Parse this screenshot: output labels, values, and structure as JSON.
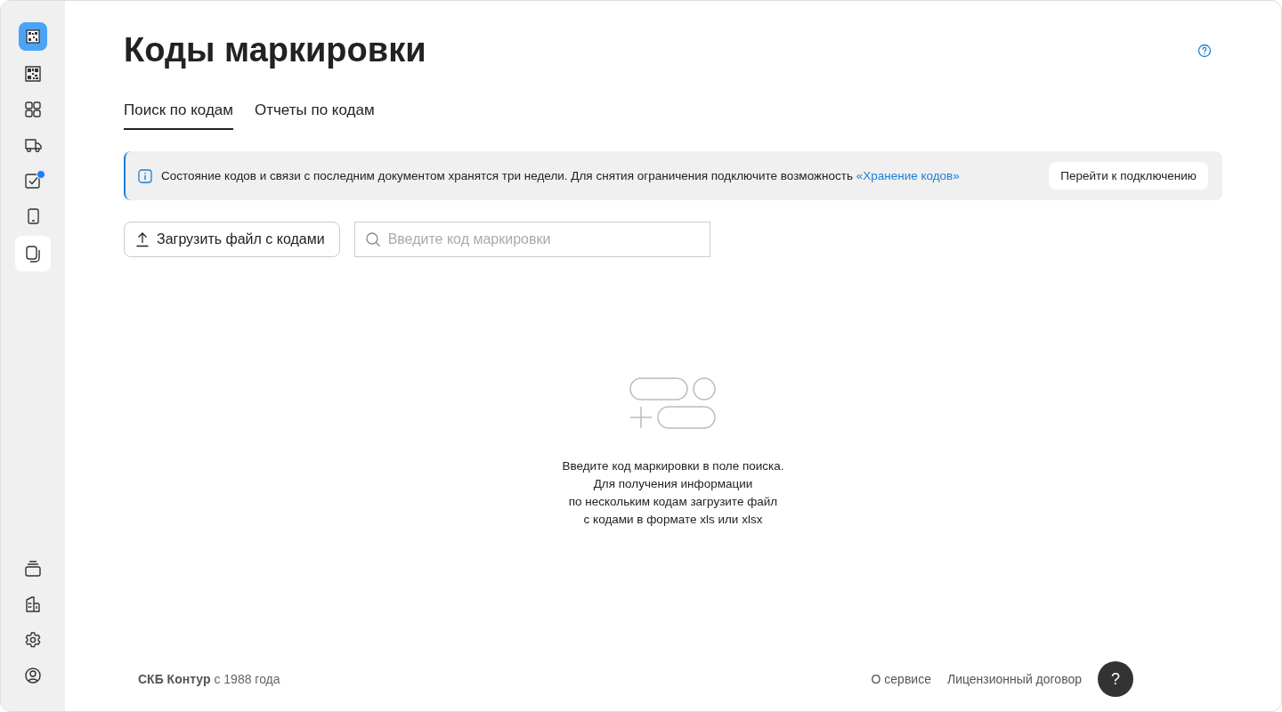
{
  "sidebar": {
    "items": [
      {
        "kind": "qr",
        "selected": false,
        "badge": false
      },
      {
        "kind": "grid",
        "selected": false,
        "badge": false
      },
      {
        "kind": "truck",
        "selected": false,
        "badge": false
      },
      {
        "kind": "check",
        "selected": false,
        "badge": true
      },
      {
        "kind": "phone",
        "selected": false,
        "badge": false
      },
      {
        "kind": "copy",
        "selected": true,
        "badge": false
      }
    ],
    "bottom_items": [
      {
        "kind": "stack"
      },
      {
        "kind": "building"
      },
      {
        "kind": "gear"
      },
      {
        "kind": "user"
      }
    ]
  },
  "title": "Коды маркировки",
  "tabs": [
    {
      "label": "Поиск по кодам",
      "selected": true
    },
    {
      "label": "Отчеты по кодам",
      "selected": false
    }
  ],
  "banner": {
    "text": "Состояние кодов и связи с последним документом хранятся три недели. Для снятия ограничения подключите возможность",
    "link": "«Хранение кодов»",
    "button": "Перейти к подключению"
  },
  "upload_button": "Загрузить файл с кодами",
  "search": {
    "placeholder": "Введите код маркировки"
  },
  "empty_state": {
    "lines": [
      "Введите код маркировки в поле поиска.",
      "Для получения информации",
      "по нескольким кодам загрузите файл",
      "с кодами в формате xls или xlsx"
    ]
  },
  "footer": {
    "copyright": "**СКБ Контур** с 1988 года",
    "links": [
      "О сервисе",
      "Лицензионный договор"
    ],
    "help_button": "?"
  }
}
